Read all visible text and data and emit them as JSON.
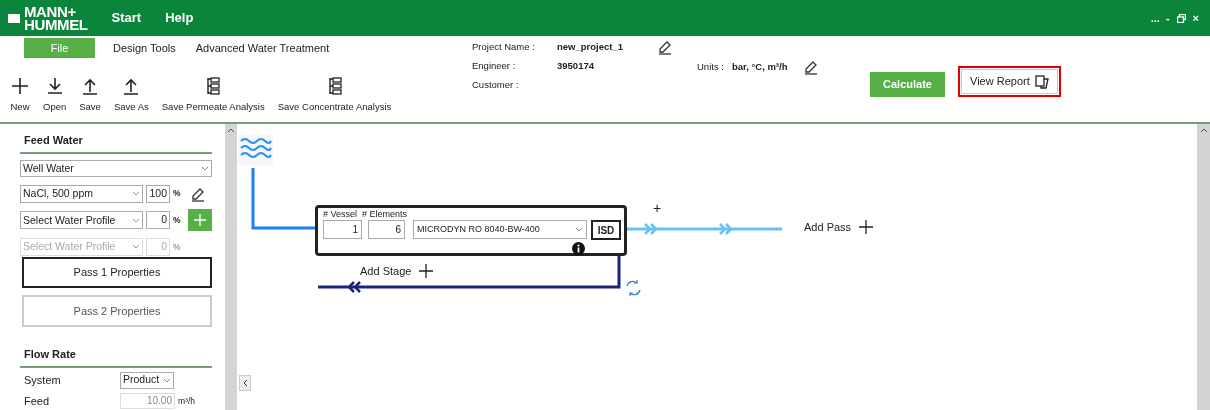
{
  "header": {
    "logo_lines": [
      "MANN+",
      "HUMMEL"
    ],
    "menu": [
      {
        "label": "Start"
      },
      {
        "label": "Help"
      }
    ],
    "window_controls": [
      "...",
      "-",
      "×"
    ]
  },
  "ribbon_tabs": [
    {
      "label": "File",
      "selected": true
    },
    {
      "label": "Design Tools",
      "selected": false
    },
    {
      "label": "Advanced Water Treatment",
      "selected": false
    }
  ],
  "toolbar": [
    {
      "kind": "new",
      "label": "New"
    },
    {
      "kind": "open",
      "label": "Open"
    },
    {
      "kind": "save",
      "label": "Save"
    },
    {
      "kind": "save",
      "label": "Save As"
    },
    {
      "kind": "analysis",
      "label": "Save Permeate Analysis"
    },
    {
      "kind": "analysis",
      "label": "Save Concentrate Analysis"
    }
  ],
  "project": [
    {
      "label": "Project Name :",
      "value": "new_project_1",
      "editable": true
    },
    {
      "label": "Engineer :",
      "value": "3950174",
      "editable": false
    },
    {
      "label": "Customer :",
      "editable": false
    }
  ],
  "units": {
    "label": "Units :",
    "value": "bar, °C, m³/h",
    "editable": true
  },
  "actions": [
    {
      "kind": "primary",
      "label": "Calculate",
      "highlighted": false
    },
    {
      "kind": "report",
      "label": "View Report",
      "highlighted": true
    }
  ],
  "feed_water": {
    "title": "Feed Water",
    "source": "Well Water",
    "profiles": [
      {
        "value": "NaCl, 500 ppm",
        "percent": "100",
        "unit": "%",
        "disabled": false,
        "kind": "edit"
      },
      {
        "value": "Select Water Profile",
        "percent": "0",
        "unit": "%",
        "disabled": false,
        "kind": "add"
      },
      {
        "value": "Select Water Profile",
        "percent": "0",
        "unit": "%",
        "disabled": true,
        "kind": "plain"
      }
    ]
  },
  "passes": [
    {
      "label": "Pass 1 Properties",
      "selected": true
    },
    {
      "label": "Pass 2 Properties",
      "selected": false
    }
  ],
  "flow_rate": {
    "title": "Flow Rate",
    "rows": [
      {
        "kind": "select",
        "label": "System",
        "value": "Product"
      },
      {
        "kind": "input",
        "label": "Feed",
        "value": "10.00",
        "unit": "m³/h",
        "disabled": true
      }
    ]
  },
  "diagram": {
    "stage": {
      "vessel_label": "# Vessel",
      "elements_label": "# Elements",
      "vessels": "1",
      "elements": "6",
      "element_model": "MICRODYN RO 8040-BW-400",
      "isd": "ISD"
    },
    "permeate_plus": "+",
    "add_pass": "Add Pass",
    "add_stage": "Add Stage"
  }
}
